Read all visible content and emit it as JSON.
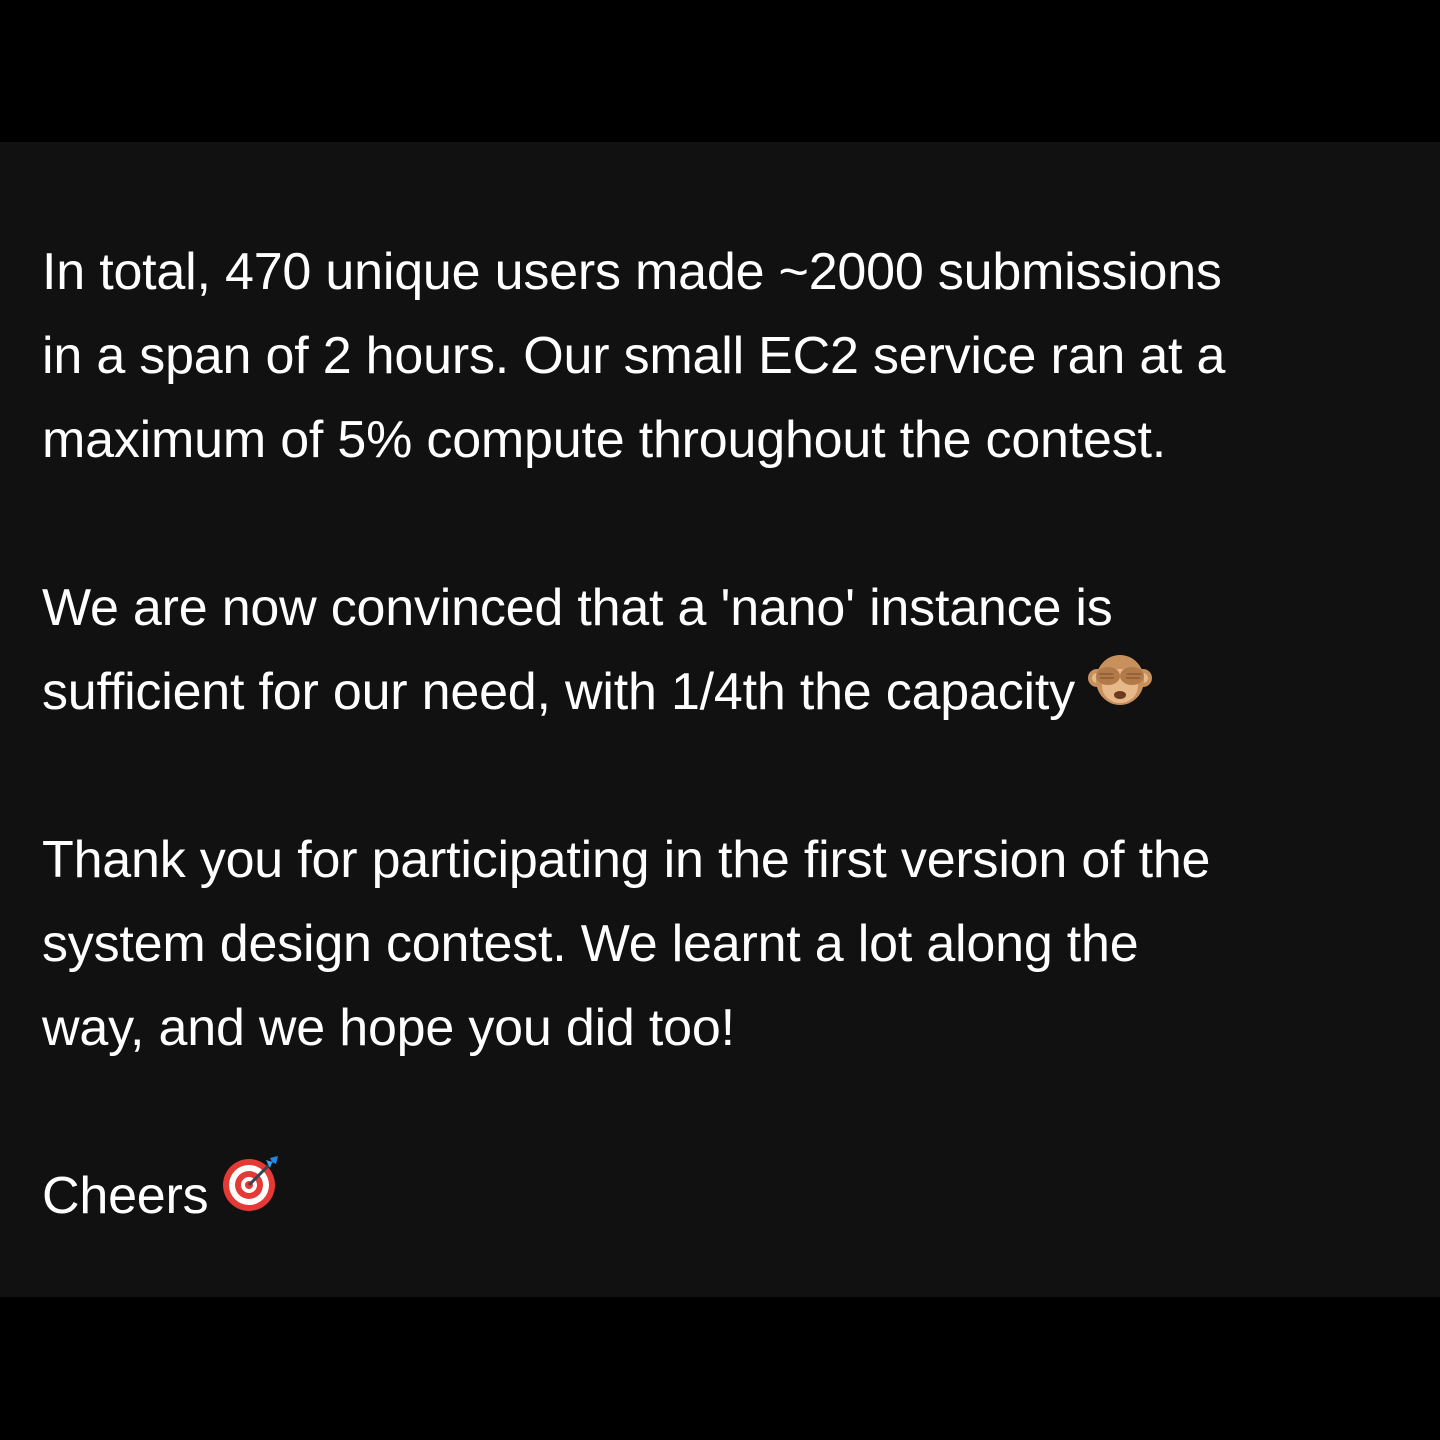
{
  "post": {
    "paragraph1": {
      "line1": "In total, 470 unique users made ~2000 submissions",
      "line2": "in a span of 2 hours. Our small EC2 service ran at a",
      "line3": "maximum of 5% compute throughout the contest."
    },
    "paragraph2": {
      "line1": "We are now convinced that a 'nano' instance is",
      "line2": "sufficient for our need, with 1/4th the capacity"
    },
    "paragraph3": {
      "line1": "Thank you for participating in the first version of the",
      "line2": "system design contest. We learnt a lot along the",
      "line3": "way, and we hope you did too!"
    },
    "signoff": "Cheers"
  },
  "icons": {
    "monkey": "see-no-evil-monkey-icon",
    "target": "direct-hit-target-icon"
  },
  "colors": {
    "outer_background": "#000000",
    "panel_background": "#111111",
    "text": "#ffffff"
  }
}
